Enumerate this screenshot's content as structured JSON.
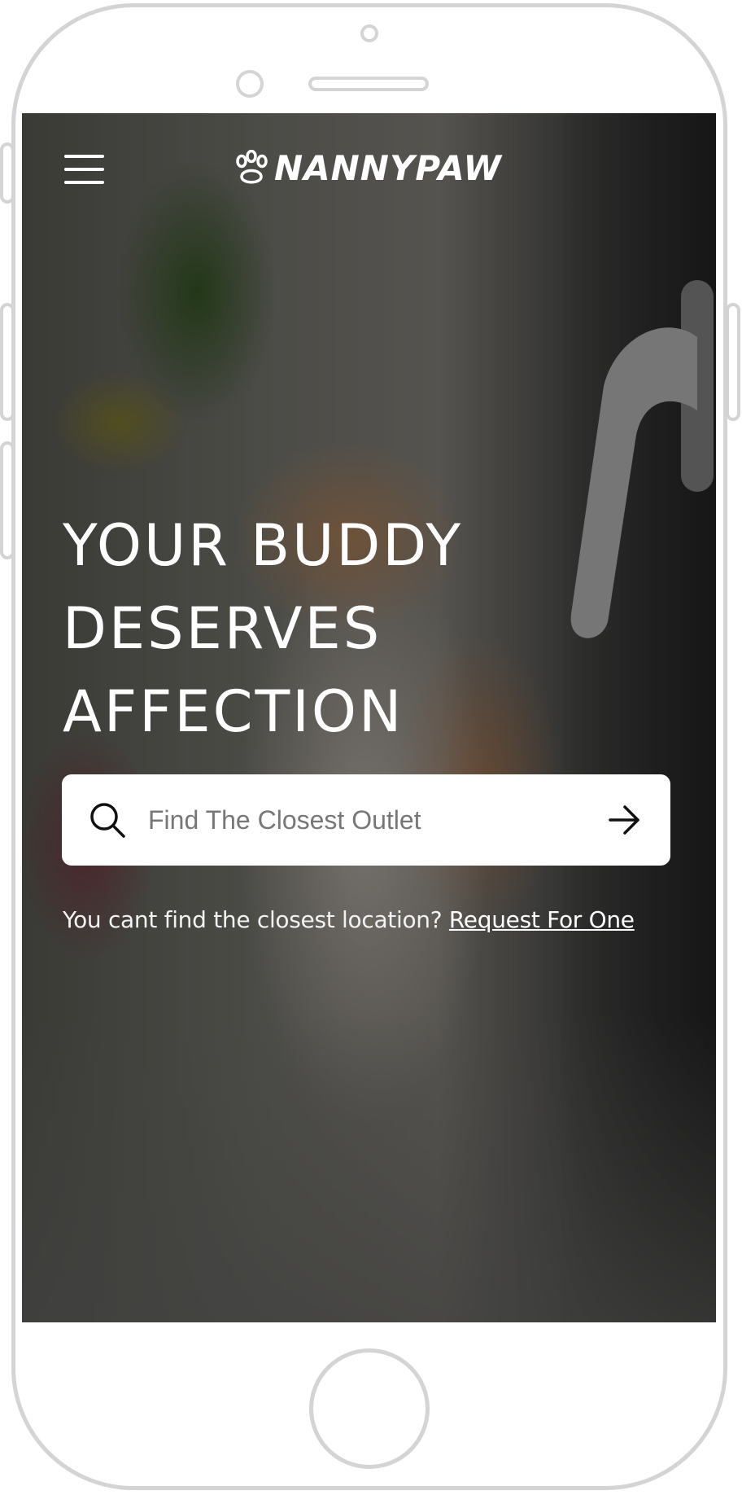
{
  "header": {
    "brand": "NANNYPAW",
    "logo_icon": "paw-icon",
    "menu_icon": "hamburger-menu-icon"
  },
  "hero": {
    "title_lines": [
      "YOUR BUDDY",
      "DESERVES",
      "AFFECTION"
    ],
    "background": "photo of an orange and white kitten looking up next to a door handle"
  },
  "search": {
    "placeholder": "Find The Closest Outlet",
    "value": "",
    "leading_icon": "search-icon",
    "submit_icon": "arrow-right-icon"
  },
  "help": {
    "text": "You cant find the closest location?",
    "link_label": "Request For One"
  },
  "colors": {
    "text": "#ffffff",
    "overlay": "rgba(0,0,0,0.45)",
    "search_bg": "#ffffff",
    "frame": "#d4d4d4"
  }
}
